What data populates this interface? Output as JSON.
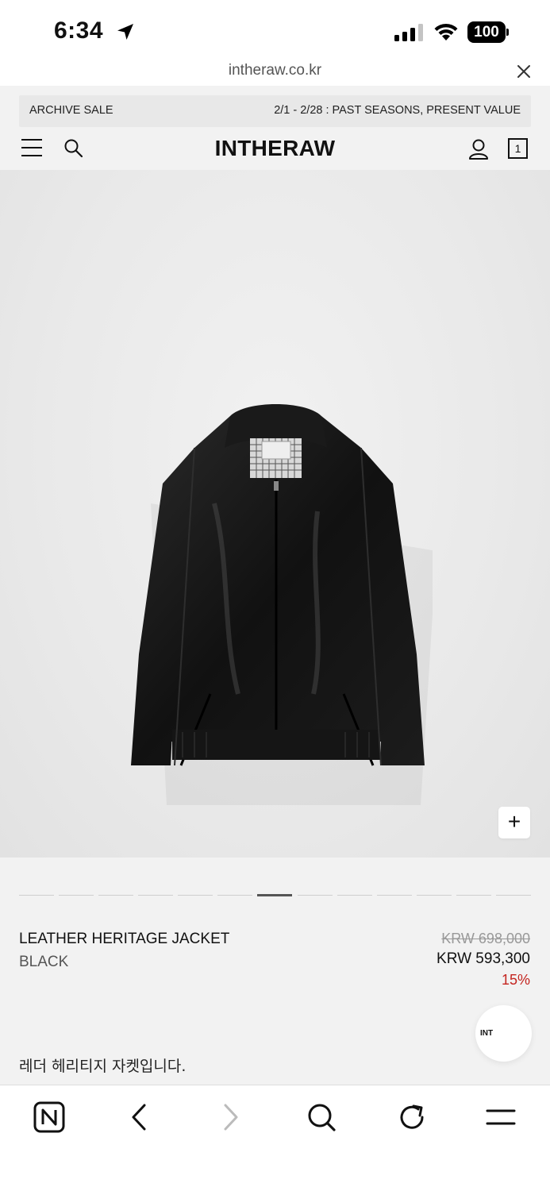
{
  "status_bar": {
    "time": "6:34",
    "battery": "100"
  },
  "browser": {
    "url": "intheraw.co.kr"
  },
  "banner": {
    "left": "ARCHIVE SALE",
    "right": "2/1 - 2/28 : PAST SEASONS, PRESENT VALUE"
  },
  "header": {
    "logo": "INTHERAW",
    "cart_count": "1"
  },
  "gallery": {
    "zoom_label": "+",
    "slide_count": 13,
    "active_slide": 7
  },
  "product": {
    "name": "LEATHER HERITAGE JACKET",
    "color": "BLACK",
    "original_price": "KRW 698,000",
    "sale_price": "KRW 593,300",
    "discount": "15%",
    "description": "레더 헤리티지 자켓입니다."
  },
  "chat_widget": {
    "label": "INT"
  },
  "colors": {
    "discount": "#c4241f",
    "background": "#f2f2f2"
  }
}
